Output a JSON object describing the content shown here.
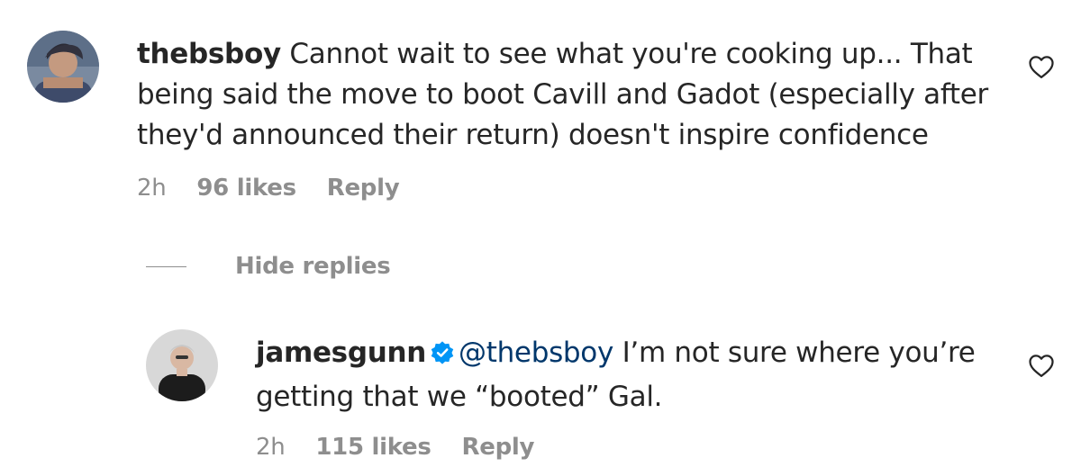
{
  "comments": [
    {
      "username": "thebsboy",
      "lines": [
        "Cannot wait to see what you're cooking up... That",
        "being said the move to boot Cavill and Gadot (especially after",
        "they'd announced their return) doesn't inspire confidence"
      ],
      "time": "2h",
      "likes": "96 likes",
      "reply_label": "Reply"
    }
  ],
  "hide_replies_label": "Hide replies",
  "reply": {
    "username": "jamesgunn",
    "verified": true,
    "mention": "@thebsboy",
    "line1_rest": " I’m not sure where you’re",
    "line2": "getting that we “booted” Gal.",
    "time": "2h",
    "likes": "115 likes",
    "reply_label": "Reply"
  },
  "colors": {
    "text": "#262626",
    "secondary": "#8e8e8e",
    "mention": "#00376b",
    "verified": "#0095f6"
  },
  "icons": [
    "heart-icon",
    "verified-badge-icon"
  ]
}
